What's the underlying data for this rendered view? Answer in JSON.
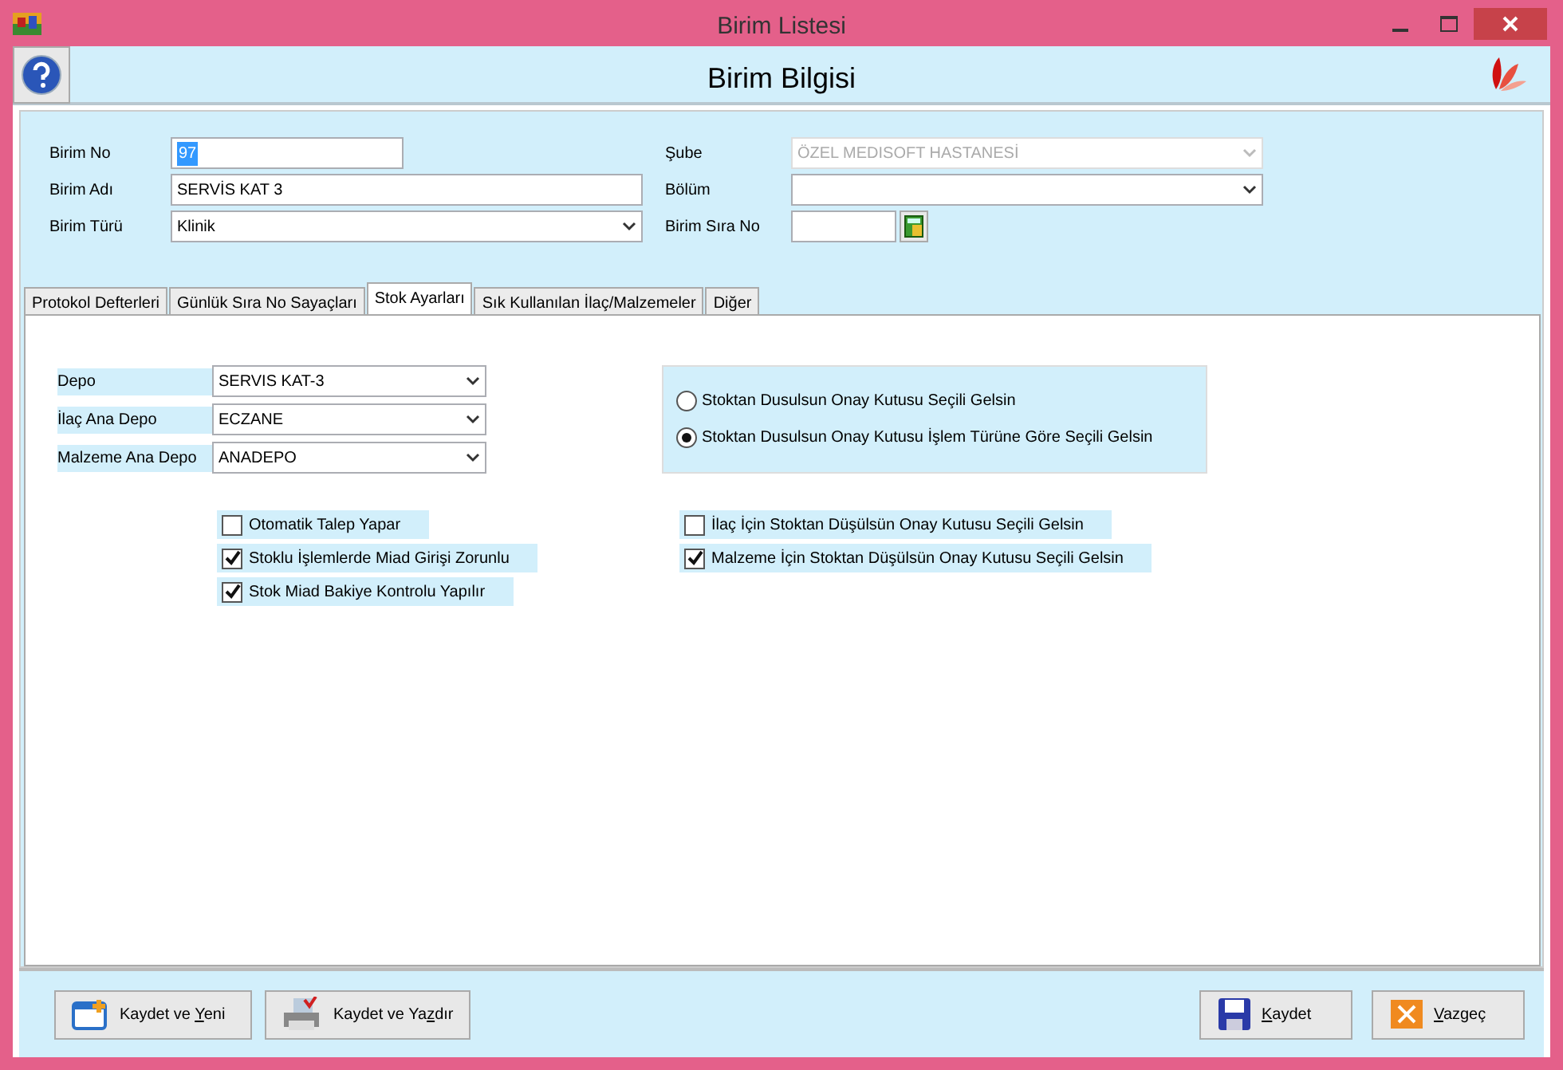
{
  "window": {
    "title": "Birim Listesi"
  },
  "header": {
    "title": "Birim Bilgisi"
  },
  "form": {
    "left": [
      {
        "label": "Birim No",
        "kind": "short-text",
        "value": "97",
        "value_selected": true
      },
      {
        "label": "Birim Adı",
        "kind": "text",
        "value": "SERVİS KAT 3",
        "value_selected": false
      },
      {
        "label": "Birim Türü",
        "kind": "select",
        "value": "Klinik",
        "disabled": false
      }
    ],
    "right": [
      {
        "label": "Şube",
        "kind": "select",
        "value": "ÖZEL MEDISOFT HASTANESİ",
        "disabled": true
      },
      {
        "label": "Bölüm",
        "kind": "select",
        "disabled": false
      },
      {
        "label": "Birim Sıra No",
        "kind": "text-button"
      }
    ]
  },
  "tabs": [
    {
      "label": "Protokol Defterleri",
      "selected": false
    },
    {
      "label": "Günlük Sıra No Sayaçları",
      "selected": false
    },
    {
      "label": "Stok Ayarları",
      "selected": true
    },
    {
      "label": "Sık Kullanılan İlaç/Malzemeler",
      "selected": false
    },
    {
      "label": "Diğer",
      "selected": false
    }
  ],
  "stock": {
    "depots": [
      {
        "label": "Depo",
        "value": "SERVIS KAT-3"
      },
      {
        "label": "İlaç Ana Depo",
        "value": "ECZANE"
      },
      {
        "label": "Malzeme Ana Depo",
        "value": "ANADEPO"
      }
    ],
    "radios": [
      {
        "label": "Stoktan Dusulsun Onay Kutusu Seçili Gelsin",
        "selected": false
      },
      {
        "label": "Stoktan Dusulsun Onay Kutusu İşlem Türüne Göre Seçili Gelsin",
        "selected": true
      }
    ],
    "checks_left": [
      {
        "label": "Otomatik Talep Yapar",
        "checked": false
      },
      {
        "label": "Stoklu İşlemlerde Miad Girişi Zorunlu",
        "checked": true
      },
      {
        "label": "Stok Miad Bakiye Kontrolu Yapılır",
        "checked": true
      }
    ],
    "checks_right": [
      {
        "label": "İlaç İçin Stoktan Düşülsün Onay Kutusu Seçili Gelsin",
        "checked": false
      },
      {
        "label": "Malzeme İçin Stoktan Düşülsün Onay Kutusu Seçili Gelsin",
        "checked": true
      }
    ]
  },
  "buttons_left": [
    {
      "kind": "new",
      "label_before": "Kaydet ve ",
      "mnemonic": "Y",
      "label_after": "eni"
    },
    {
      "kind": "print",
      "label_before": "Kaydet ve Ya",
      "mnemonic": "z",
      "label_after": "dır"
    }
  ],
  "buttons_right": [
    {
      "kind": "save",
      "mnemonic": "K",
      "label_after": "aydet"
    },
    {
      "kind": "cancel",
      "mnemonic": "V",
      "label_after": "azgeç"
    }
  ]
}
